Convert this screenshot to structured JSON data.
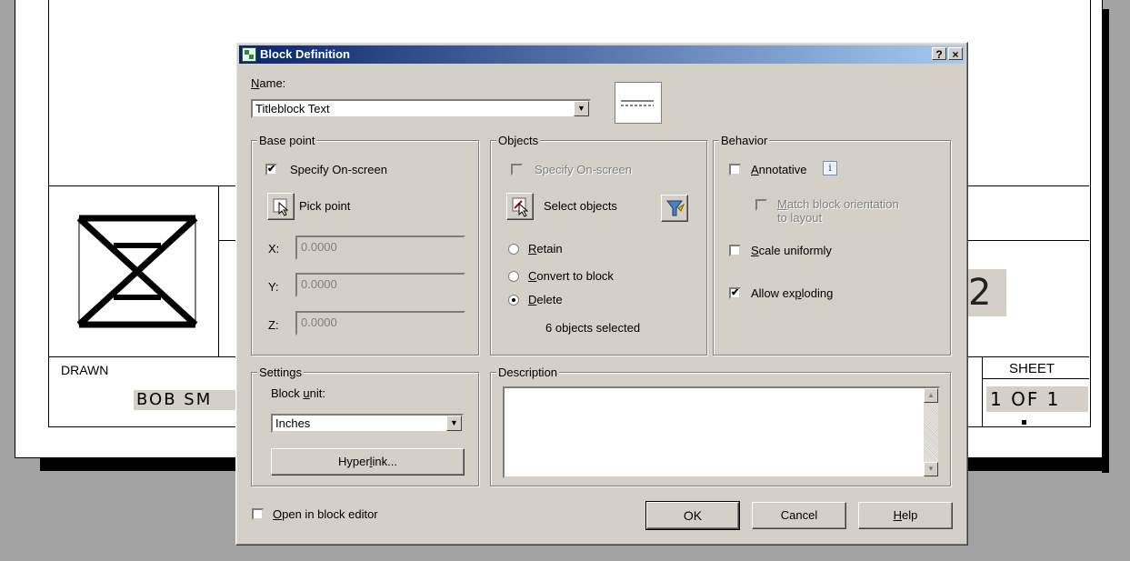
{
  "background": {
    "drawn_label": "DRAWN",
    "drawn_value": "BOB SM",
    "sheet_label": "SHEET",
    "sheet_value": "1 OF 1",
    "rev_value": "2"
  },
  "dialog": {
    "title": "Block Definition",
    "help_glyph": "?",
    "close_glyph": "×",
    "name_label": "Name:",
    "name_value": "Titleblock Text",
    "base_point": {
      "title": "Base point",
      "specify_onscreen": "Specify On-screen",
      "specify_checked": true,
      "pick_point": "Pick point",
      "x_label": "X:",
      "x_value": "0.0000",
      "y_label": "Y:",
      "y_value": "0.0000",
      "z_label": "Z:",
      "z_value": "0.0000"
    },
    "objects": {
      "title": "Objects",
      "specify_onscreen": "Specify On-screen",
      "select_objects": "Select objects",
      "retain": "Retain",
      "convert": "Convert to block",
      "delete": "Delete",
      "selected_radio": "Delete",
      "count_text": "6 objects selected"
    },
    "behavior": {
      "title": "Behavior",
      "annotative": "Annotative",
      "info_glyph": "i",
      "match_line1": "Match block orientation",
      "match_line2": "to layout",
      "scale_uniformly": "Scale uniformly",
      "allow_exploding": "Allow exploding",
      "annotative_checked": false,
      "scale_checked": false,
      "explode_checked": true
    },
    "settings": {
      "title": "Settings",
      "block_unit_label": "Block unit:",
      "block_unit_value": "Inches",
      "hyperlink": "Hyperlink..."
    },
    "description": {
      "title": "Description",
      "value": ""
    },
    "open_in_editor": "Open in block editor",
    "open_checked": false,
    "ok": "OK",
    "cancel": "Cancel",
    "help": "Help"
  }
}
